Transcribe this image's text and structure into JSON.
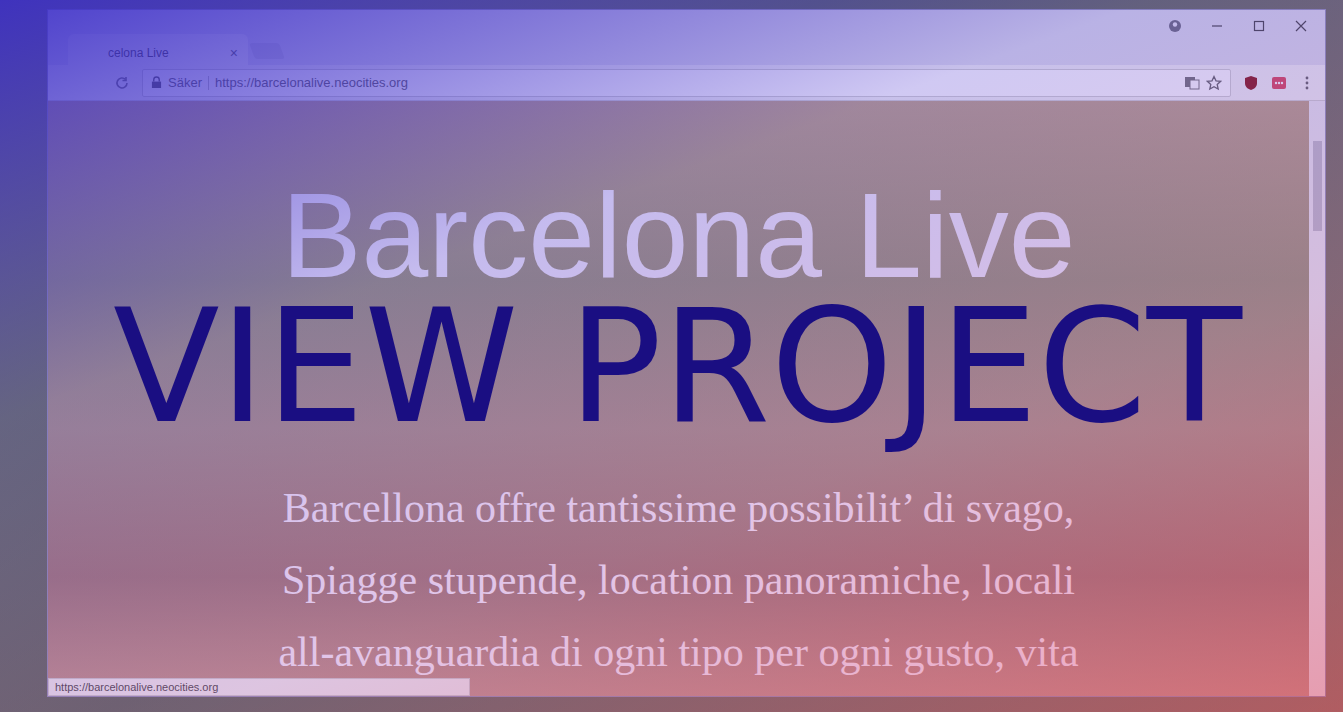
{
  "window": {
    "tab": {
      "title": "celona Live",
      "close": "×",
      "selected": true
    }
  },
  "address_bar": {
    "security": "Säker",
    "url": "https://barcelonalive.neocities.org"
  },
  "page": {
    "heading": "Barcelona Live",
    "paragraph_lines": [
      "Barcellona offre tantissime possibilit’ di svago,",
      "Spiagge stupende, location panoramiche, locali",
      "all-avanguardia di ogni tipo per ogni gusto, vita"
    ]
  },
  "overlay": {
    "button": "VIEW PROJECT"
  },
  "status_bar": {
    "url": "https://barcelonalive.neocities.org"
  }
}
